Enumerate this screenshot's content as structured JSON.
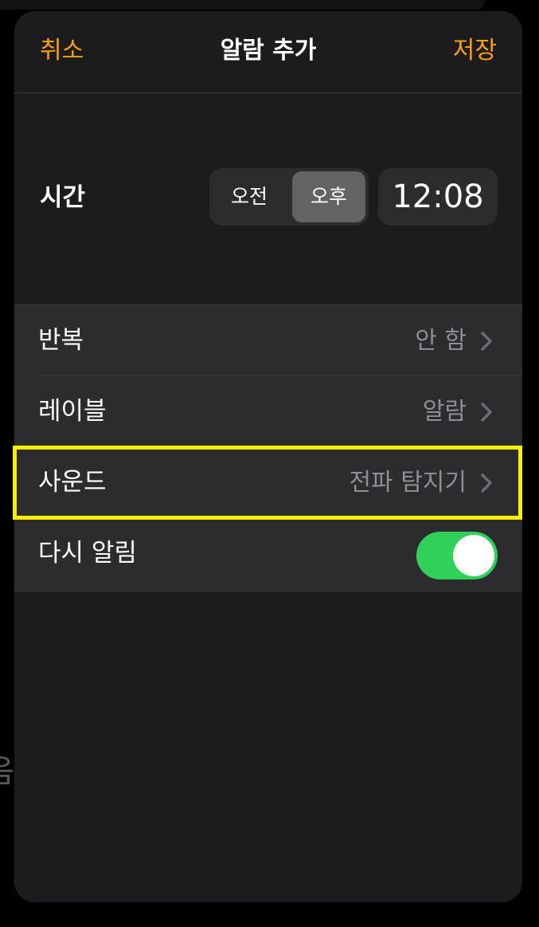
{
  "background": {
    "peek_text": "음"
  },
  "navbar": {
    "cancel_label": "취소",
    "title": "알람 추가",
    "save_label": "저장"
  },
  "time": {
    "label": "시간",
    "am_label": "오전",
    "pm_label": "오후",
    "selected_period": "오후",
    "value": "12:08"
  },
  "options": {
    "repeat": {
      "label": "반복",
      "value": "안 함"
    },
    "label": {
      "label": "레이블",
      "value": "알람"
    },
    "sound": {
      "label": "사운드",
      "value": "전파 탐지기"
    },
    "snooze": {
      "label": "다시 알림",
      "on": true
    }
  },
  "colors": {
    "accent": "#ff9f0a",
    "toggle_on": "#30d158",
    "highlight": "#ffee00",
    "sheet": "#1c1c1e",
    "cell": "#2c2c2e"
  },
  "icons": {
    "chevron": "chevron-right-icon"
  }
}
